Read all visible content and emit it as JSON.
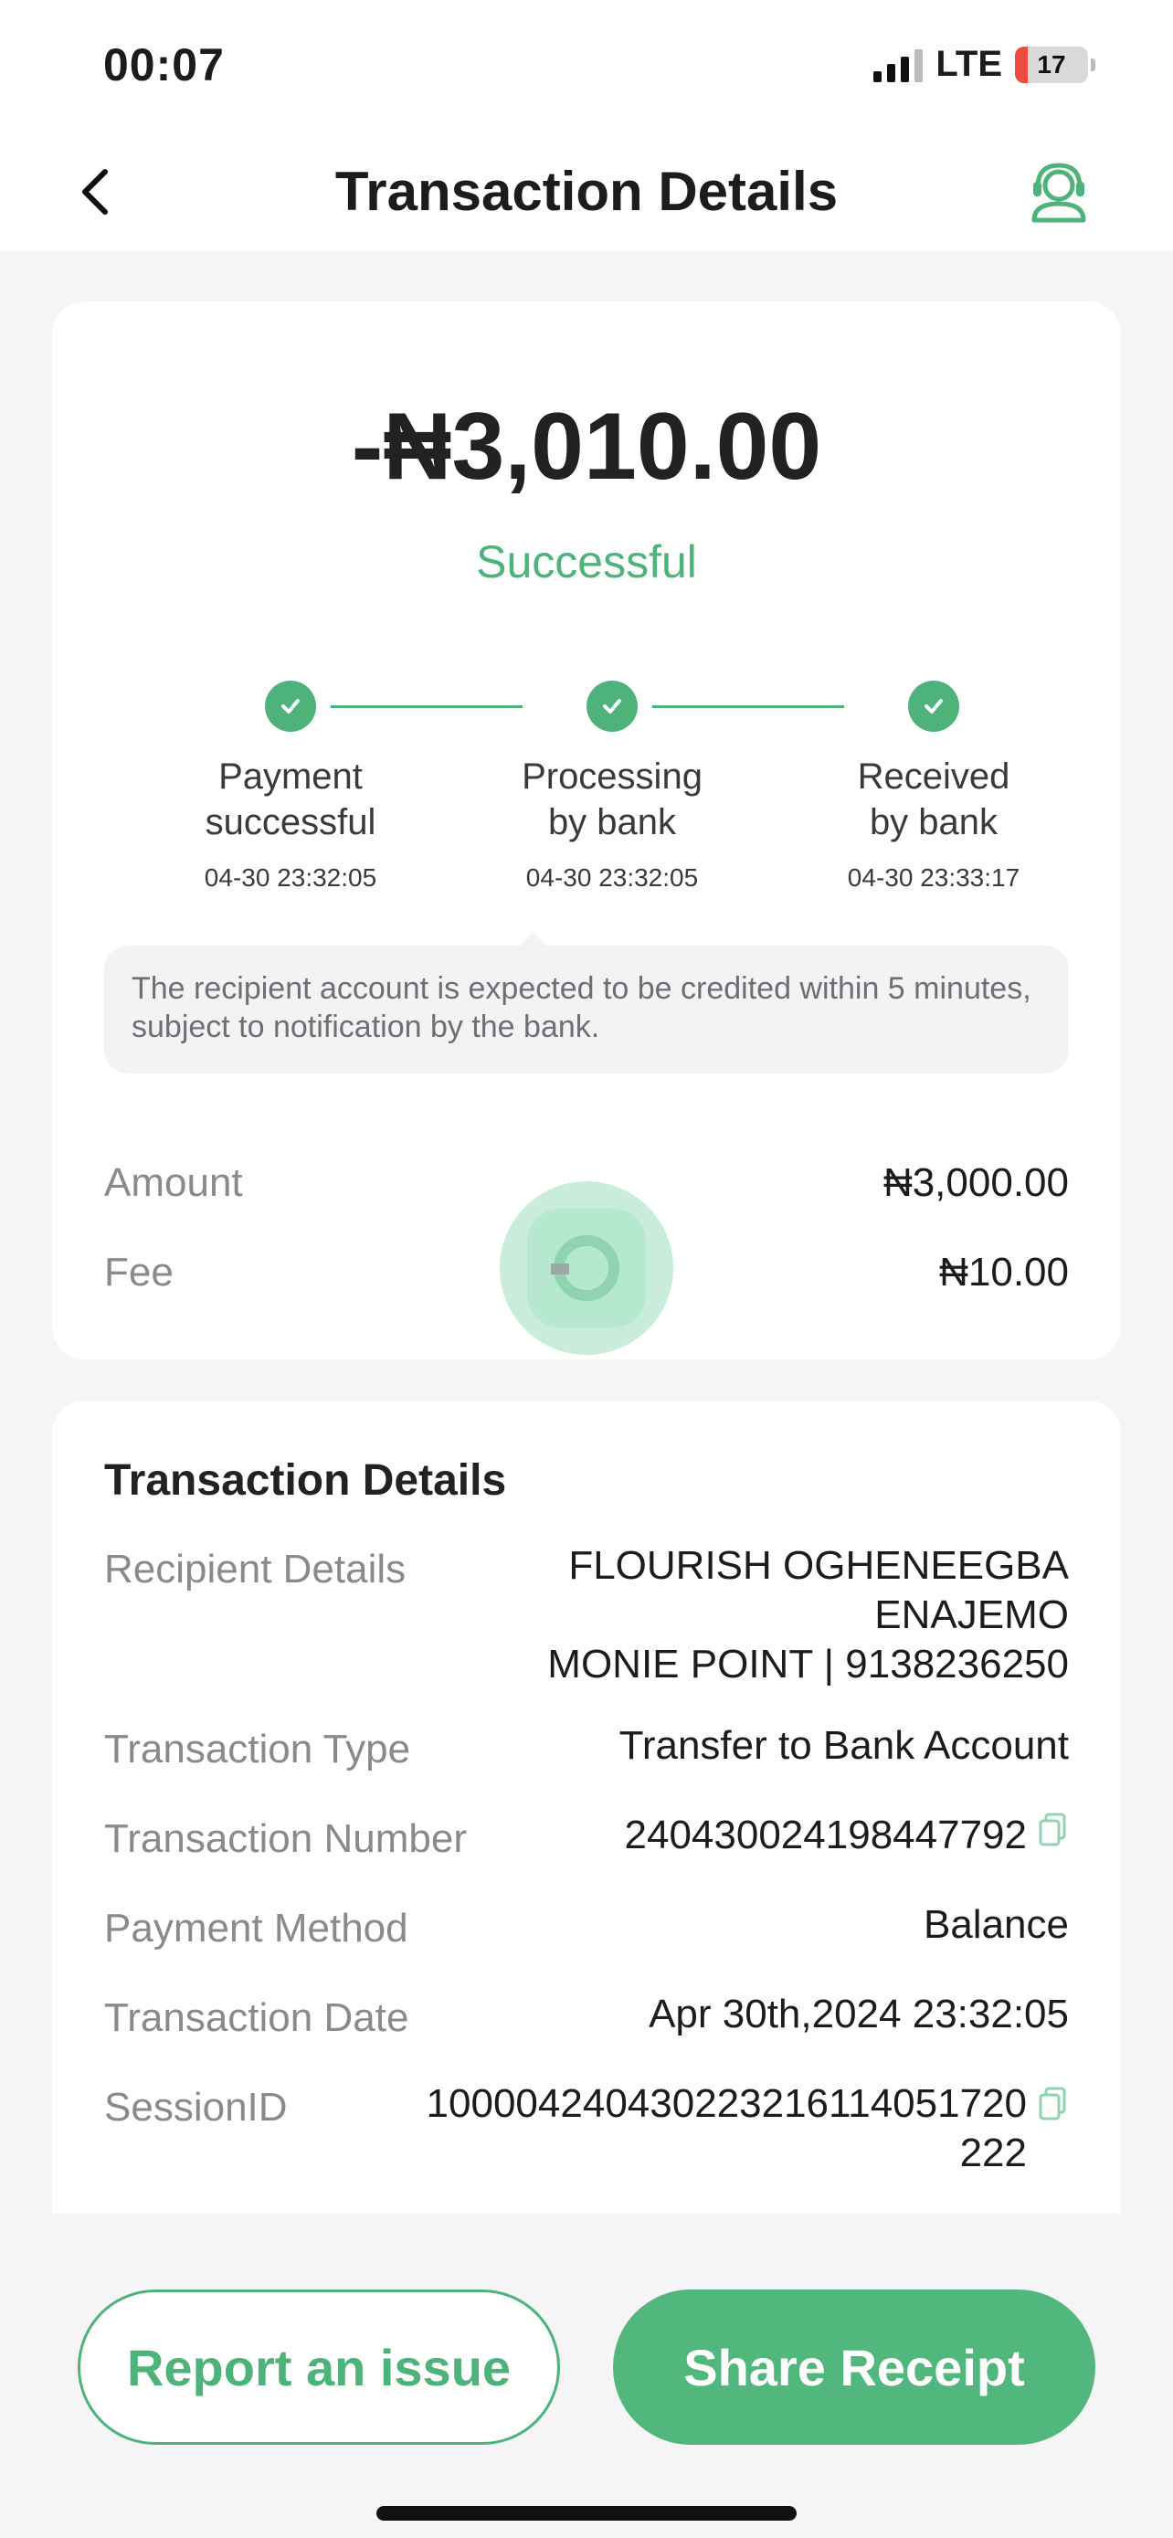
{
  "status_bar": {
    "time": "00:07",
    "network": "LTE",
    "battery": "17",
    "battery_level": 0.17
  },
  "header": {
    "title": "Transaction Details",
    "back_icon": "chevron-left-icon",
    "support_icon": "customer-support-icon"
  },
  "summary": {
    "amount": "-₦3,010.00",
    "status": "Successful",
    "steps": [
      {
        "label": "Payment\nsuccessful",
        "time": "04-30 23:32:05"
      },
      {
        "label": "Processing\nby bank",
        "time": "04-30 23:32:05"
      },
      {
        "label": "Received\nby bank",
        "time": "04-30 23:33:17"
      }
    ],
    "notice": "The recipient account is expected to be credited within 5 minutes, subject to notification by the bank.",
    "amount_label": "Amount",
    "amount_value": "₦3,000.00",
    "fee_label": "Fee",
    "fee_value": "₦10.00"
  },
  "details": {
    "title": "Transaction Details",
    "rows": [
      {
        "label": "Recipient Details",
        "value": "FLOURISH OGHENEEGBA\nENAJEMO\nMONIE POINT | 9138236250"
      },
      {
        "label": "Transaction Type",
        "value": "Transfer to Bank Account"
      },
      {
        "label": "Transaction Number",
        "value": "240430024198447792"
      },
      {
        "label": "Payment Method",
        "value": "Balance"
      },
      {
        "label": "Transaction Date",
        "value": "Apr 30th,2024 23:32:05"
      },
      {
        "label": "SessionID",
        "value": "100004240430223216114051720\n222"
      }
    ]
  },
  "actions": {
    "report_label": "Report an issue",
    "share_label": "Share Receipt"
  },
  "colors": {
    "accent": "#4db37a",
    "background": "#f5f5f7",
    "card": "#ffffff"
  }
}
